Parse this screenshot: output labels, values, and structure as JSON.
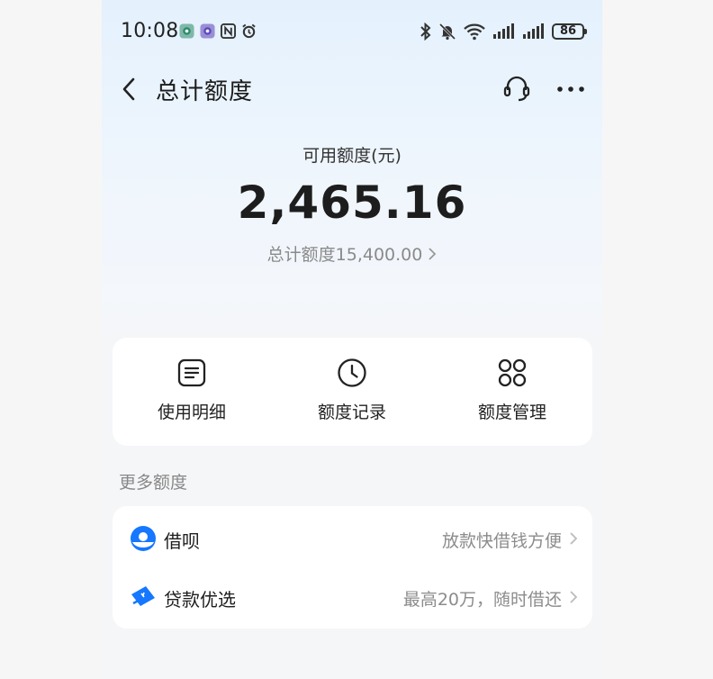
{
  "status_bar": {
    "time": "10:08",
    "battery": "86"
  },
  "header": {
    "title": "总计额度"
  },
  "summary": {
    "available_label": "可用额度(元)",
    "available_amount": "2,465.16",
    "total_label": "总计额度15,400.00"
  },
  "actions": [
    {
      "label": "使用明细",
      "icon": "document-list-icon"
    },
    {
      "label": "额度记录",
      "icon": "clock-icon"
    },
    {
      "label": "额度管理",
      "icon": "grid-apps-icon"
    }
  ],
  "more_section": {
    "title": "更多额度",
    "items": [
      {
        "name": "借呗",
        "desc": "放款快借钱方便",
        "icon": "jiebei-logo-icon"
      },
      {
        "name": "贷款优选",
        "desc": "最高20万，随时借还",
        "icon": "loan-ticket-icon"
      }
    ]
  },
  "colors": {
    "accent_blue": "#1677ff",
    "header_gradient_top": "#e4f1fd",
    "page_bg": "#f5f6f8"
  }
}
